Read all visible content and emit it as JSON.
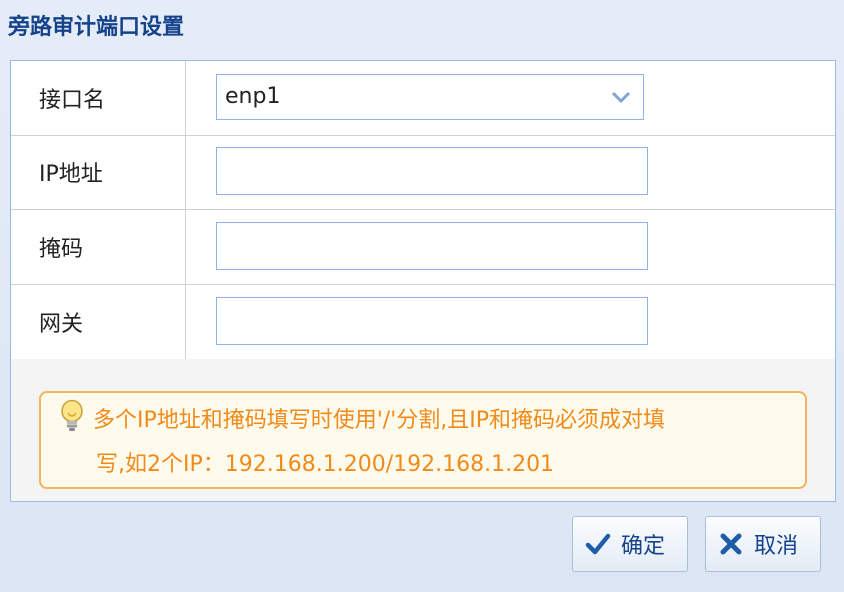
{
  "dialog": {
    "title": "旁路审计端口设置"
  },
  "form": {
    "interface_label": "接口名",
    "interface_value": "enp1",
    "ip_label": "IP地址",
    "ip_value": "",
    "mask_label": "掩码",
    "mask_value": "",
    "gateway_label": "网关",
    "gateway_value": ""
  },
  "tip": {
    "icon": "lightbulb-icon",
    "line1": "多个IP地址和掩码填写时使用'/'分割,且IP和掩码必须成对填",
    "line2": "写,如2个IP：192.168.1.200/192.168.1.201"
  },
  "buttons": {
    "confirm_label": "确定",
    "confirm_icon": "checkmark-icon",
    "cancel_label": "取消",
    "cancel_icon": "x-icon"
  },
  "colors": {
    "title": "#15428b",
    "input_border": "#8fb3e3",
    "tip_text": "#f08a1a",
    "tip_border": "#f5b25f"
  }
}
